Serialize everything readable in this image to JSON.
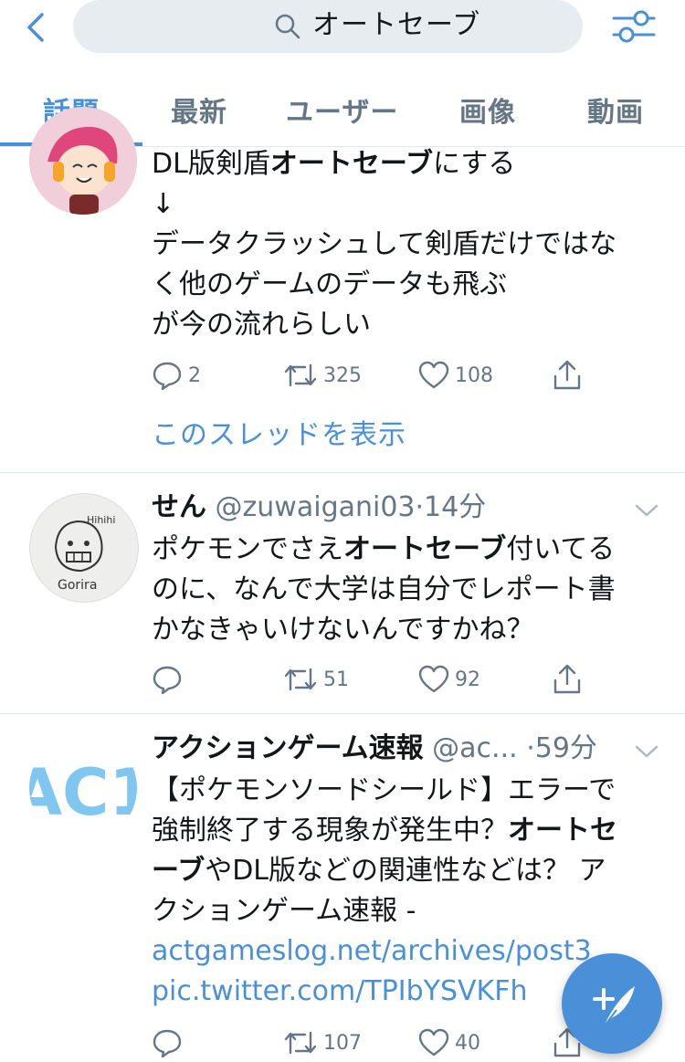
{
  "search": {
    "query": "オートセーブ"
  },
  "tabs": [
    "話題",
    "最新",
    "ユーザー",
    "画像",
    "動画"
  ],
  "tweets": [
    {
      "lines": [
        [
          {
            "t": "DL版剣盾"
          },
          {
            "t": "オートセーブ",
            "b": true
          },
          {
            "t": "にする"
          }
        ],
        [
          {
            "t": "↓"
          }
        ],
        [
          {
            "t": "データクラッシュして剣盾だけではな"
          }
        ],
        [
          {
            "t": "く他のゲームのデータも飛ぶ"
          }
        ],
        [
          {
            "t": "が今の流れらしい"
          }
        ]
      ],
      "replies": "2",
      "retweets": "325",
      "likes": "108",
      "thread_link": "このスレッドを表示"
    },
    {
      "name": "せん",
      "handle": "@zuwaigani03",
      "time": "·14分",
      "avatar_text": [
        "Hihihi",
        "Gorira"
      ],
      "lines": [
        [
          {
            "t": "ポケモンでさえ"
          },
          {
            "t": "オートセーブ",
            "b": true
          },
          {
            "t": "付いてる"
          }
        ],
        [
          {
            "t": "のに、なんで大学は自分でレポート書"
          }
        ],
        [
          {
            "t": "かなきゃいけないんですかね？"
          }
        ]
      ],
      "replies": "",
      "retweets": "51",
      "likes": "92"
    },
    {
      "name": "アクションゲーム速報",
      "handle": "@ac...",
      "time": "·59分",
      "avatar_text": "AC1",
      "lines": [
        [
          {
            "t": "【ポケモンソードシールド】エラーで"
          }
        ],
        [
          {
            "t": "強制終了する現象が発生中？"
          },
          {
            "t": "オートセ",
            "b": true
          }
        ],
        [
          {
            "t": "ーブ",
            "b": true
          },
          {
            "t": "やDL版などの関連性などは？ ア"
          }
        ],
        [
          {
            "t": "クションゲーム速報 -"
          }
        ],
        [
          {
            "t": "actgameslog.net/archives/post3",
            "link": true
          }
        ],
        [
          {
            "t": "pic.twitter.com/TPIbYSVKFh",
            "link": true
          }
        ]
      ],
      "replies": "",
      "retweets": "107",
      "likes": "40"
    }
  ],
  "colors": {
    "accent": "#4a90d9",
    "muted": "#657786",
    "border": "#e1e8ed",
    "search_bg": "#e6ecf0"
  },
  "icons": [
    "back-chevron-icon",
    "search-icon",
    "filter-sliders-icon",
    "reply-icon",
    "retweet-icon",
    "like-icon",
    "share-icon",
    "compose-tweet-icon"
  ]
}
